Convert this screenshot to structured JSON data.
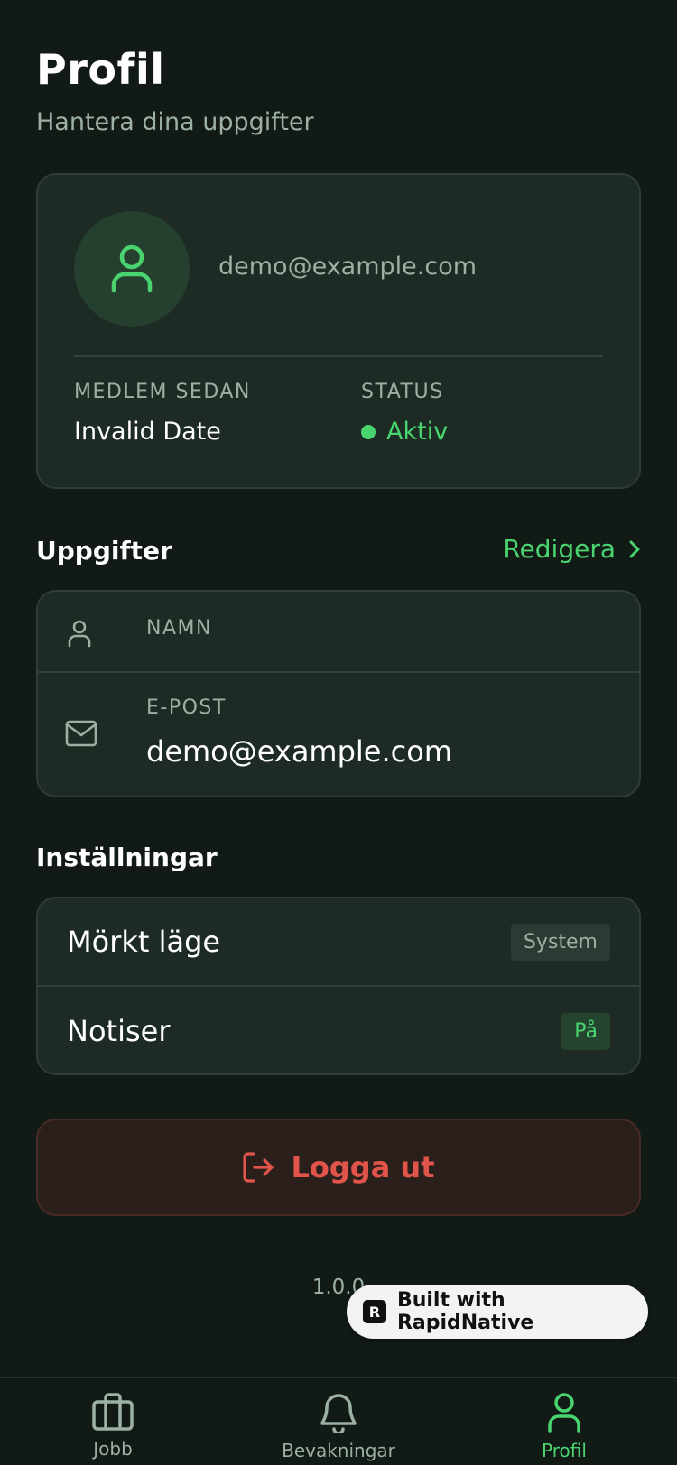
{
  "header": {
    "title": "Profil",
    "subtitle": "Hantera dina uppgifter"
  },
  "profile": {
    "email": "demo@example.com",
    "member_since_label": "MEDLEM SEDAN",
    "member_since_value": "Invalid Date",
    "status_label": "STATUS",
    "status_value": "Aktiv",
    "avatar_icon": "user-icon"
  },
  "details": {
    "title": "Uppgifter",
    "edit_label": "Redigera",
    "rows": [
      {
        "icon": "user-icon",
        "label": "NAMN",
        "value": ""
      },
      {
        "icon": "mail-icon",
        "label": "E-POST",
        "value": "demo@example.com"
      }
    ]
  },
  "settings": {
    "title": "Inställningar",
    "rows": [
      {
        "label": "Mörkt läge",
        "value": "System"
      },
      {
        "label": "Notiser",
        "value": "På"
      }
    ]
  },
  "logout": {
    "label": "Logga ut",
    "icon": "logout-icon"
  },
  "version": "1.0.0",
  "built_with": {
    "label": "Built with RapidNative",
    "logo_letter": "R"
  },
  "nav": {
    "items": [
      {
        "label": "Jobb",
        "icon": "briefcase-icon",
        "active": false
      },
      {
        "label": "Bevakningar",
        "icon": "bell-icon",
        "active": false
      },
      {
        "label": "Profil",
        "icon": "user-icon",
        "active": true
      }
    ]
  },
  "colors": {
    "background": "#121a16",
    "card": "#1e2a24",
    "accent": "#4ad46f",
    "danger": "#e0544a",
    "muted": "#9db0a5"
  }
}
